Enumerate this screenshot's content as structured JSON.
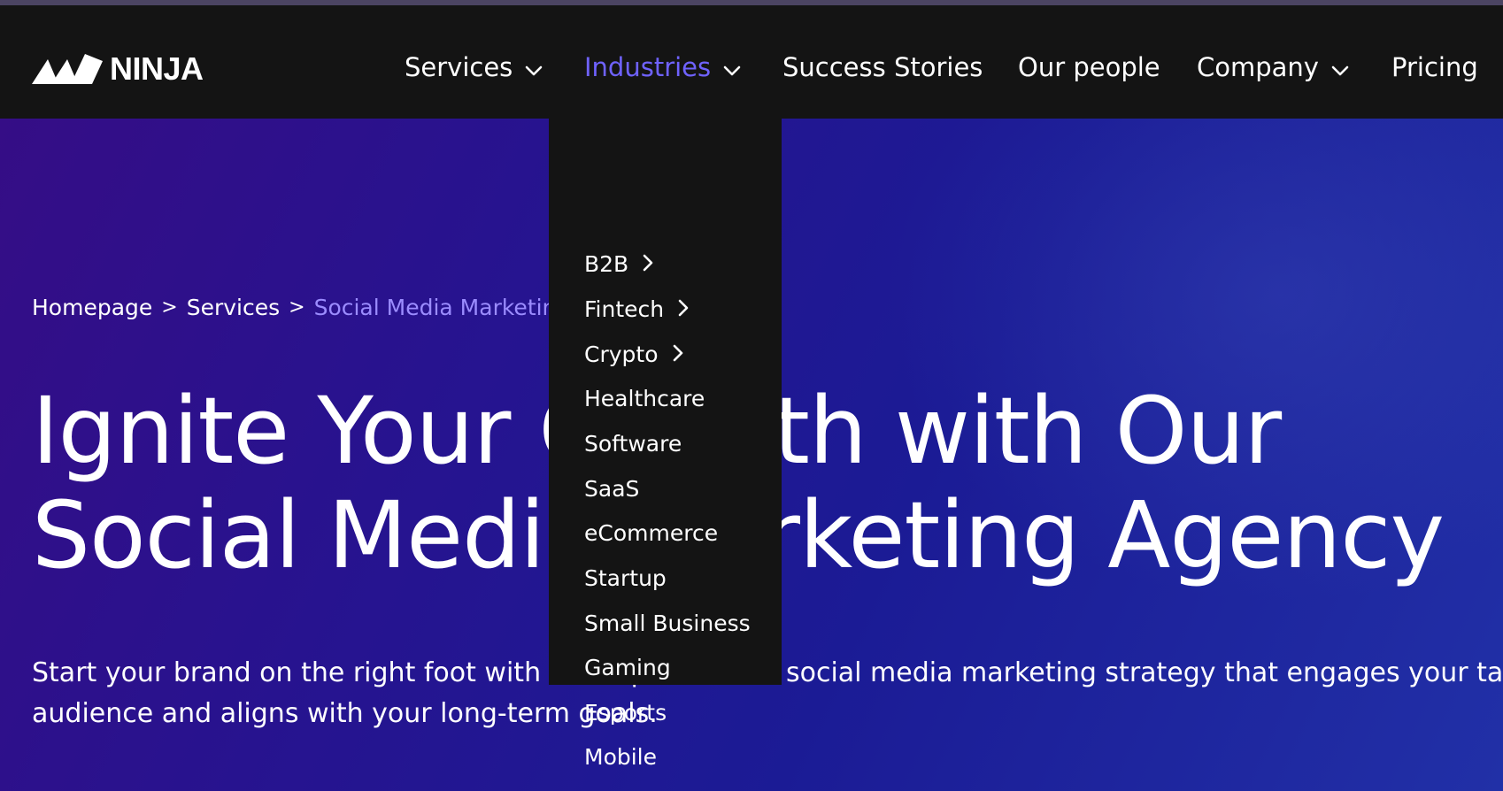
{
  "brand": {
    "name": "NINJA"
  },
  "nav": {
    "services": "Services",
    "industries": "Industries",
    "success_stories": "Success Stories",
    "our_people": "Our people",
    "company": "Company",
    "pricing": "Pricing"
  },
  "industries_menu": {
    "items": [
      {
        "label": "B2B",
        "has_submenu": true
      },
      {
        "label": "Fintech",
        "has_submenu": true
      },
      {
        "label": "Crypto",
        "has_submenu": true
      },
      {
        "label": "Healthcare",
        "has_submenu": false
      },
      {
        "label": "Software",
        "has_submenu": false
      },
      {
        "label": "SaaS",
        "has_submenu": false
      },
      {
        "label": "eCommerce",
        "has_submenu": false
      },
      {
        "label": "Startup",
        "has_submenu": false
      },
      {
        "label": "Small Business",
        "has_submenu": false
      },
      {
        "label": "Gaming",
        "has_submenu": false
      },
      {
        "label": "Esports",
        "has_submenu": false
      },
      {
        "label": "Mobile",
        "has_submenu": false
      }
    ]
  },
  "breadcrumb": {
    "home": "Homepage",
    "sep1": ">",
    "services": "Services",
    "sep2": ">",
    "current": "Social Media Marketing"
  },
  "hero": {
    "headline_line1": "Ignite Your Growth with Our",
    "headline_line2": "Social Media Marketing Agency",
    "subtext_line1": "Start your brand on the right foot with a comprehensive social media marketing strategy that engages your target",
    "subtext_line2": "audience and aligns with your long-term goals."
  },
  "colors": {
    "nav_bg": "#141414",
    "accent": "#6f62ff",
    "breadcrumb_current": "#9b8cff",
    "hero_gradient_start": "#350d86",
    "hero_gradient_end": "#2130a7"
  },
  "icons": {
    "logo": "ninja-mountain-logo",
    "dropdown": "chevron-down-icon",
    "submenu": "chevron-right-icon"
  }
}
